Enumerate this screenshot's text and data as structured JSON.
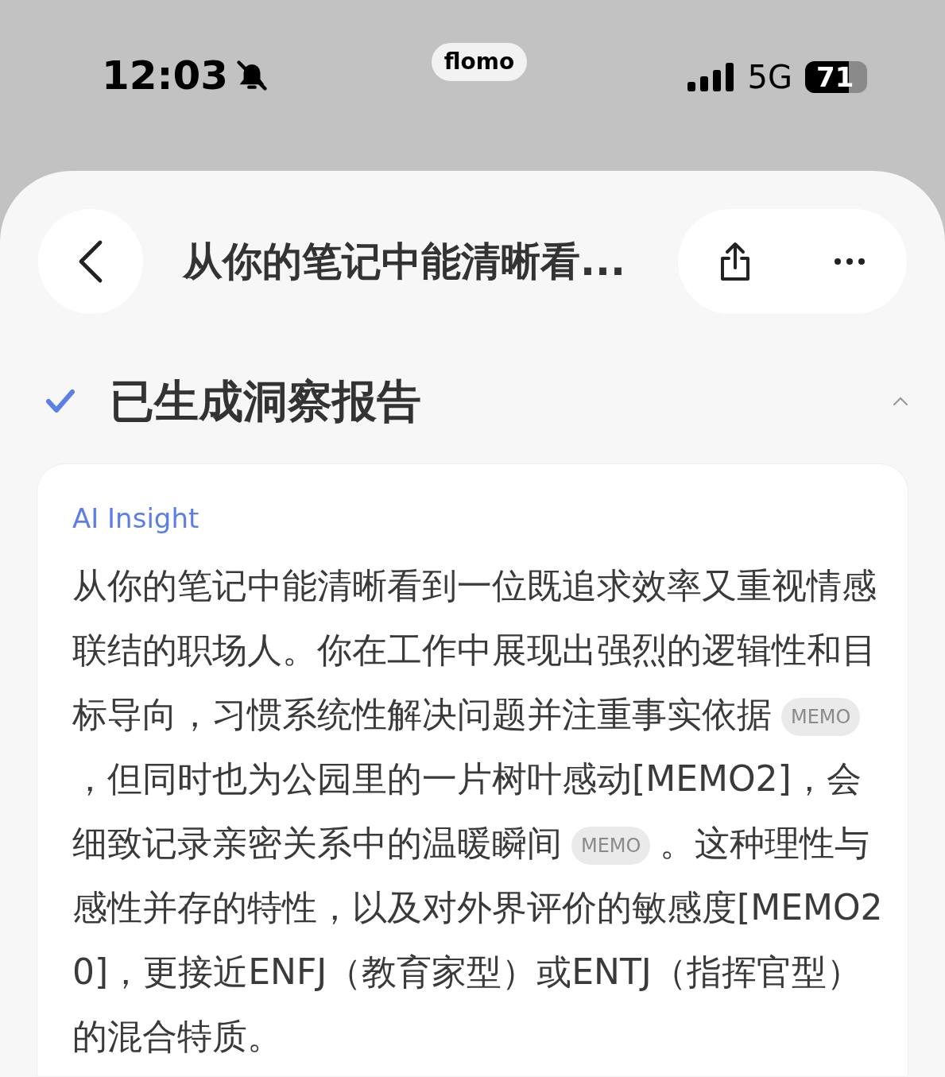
{
  "status_bar": {
    "time": "12:03",
    "app_pill": "flomo",
    "network": "5G",
    "battery": "71"
  },
  "header": {
    "title": "从你的笔记中能清晰看..."
  },
  "section": {
    "title": "已生成洞察报告",
    "done": true,
    "expanded": true
  },
  "card": {
    "label": "AI Insight",
    "paragraph": [
      {
        "kind": "text",
        "text": "从你的笔记中能清晰看到一位既追求效率又重视情感联结的职场人。你在工作中展现出强烈的逻辑性和目标导向，习惯系统性解决问题并注重事实依据"
      },
      {
        "kind": "memo",
        "label": "MEMO"
      },
      {
        "kind": "text",
        "text": "，但同时也为公园里的一片树叶感动[MEMO2]，会细致记录亲密关系中的温暖瞬间"
      },
      {
        "kind": "memo",
        "label": "MEMO"
      },
      {
        "kind": "text",
        "text": "。这种理性与感性并存的特性，以及对外界评价的敏感度[MEMO20]，更接近ENFJ（教育家型）或ENTJ（指挥官型）的混合特质。"
      }
    ]
  }
}
